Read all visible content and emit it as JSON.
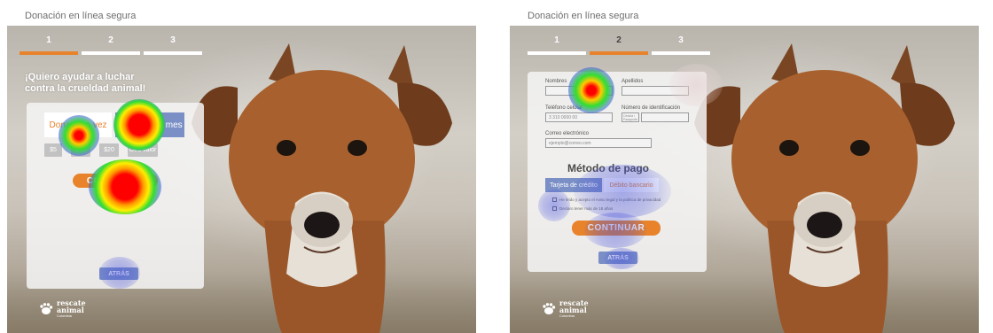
{
  "left": {
    "title": "Donación en línea segura",
    "steps": [
      "1",
      "2",
      "3"
    ],
    "active_step": 1,
    "headline": "¡Quiero ayudar a luchar contra la crueldad animal!",
    "tab_once": "Donar una vez",
    "tab_monthly": "Donar cada mes",
    "amounts": [
      "$5",
      "$10",
      "$20",
      "Otro valor"
    ],
    "cta": "CONTINUAR",
    "back": "ATRÁS"
  },
  "right": {
    "title": "Donación en línea segura",
    "steps": [
      "1",
      "2",
      "3"
    ],
    "active_step": 2,
    "fields": {
      "first_name_label": "Nombres",
      "last_name_label": "Apellidos",
      "phone_label": "Teléfono celular",
      "phone_placeholder": "3 310 0000 00",
      "id_label": "Número de identificación",
      "id_type": "Cédula / Pasaporte",
      "email_label": "Correo electrónico",
      "email_placeholder": "ejemplo@correo.com"
    },
    "payment_title": "Método de pago",
    "pay_card": "Tarjeta de crédito",
    "pay_bank": "Débito bancario",
    "check_terms": "He leído y acepto el Aviso legal y la política de privacidad",
    "check_age": "Declaro tener más de 18 años",
    "cta": "CONTINUAR",
    "back": "ATRÁS"
  },
  "logo": {
    "line1": "rescate",
    "line2": "animal",
    "sub": "Colombia"
  },
  "colors": {
    "accent": "#e8832c",
    "secondary": "#7a8fc6",
    "title_text": "#6f6f6f"
  }
}
